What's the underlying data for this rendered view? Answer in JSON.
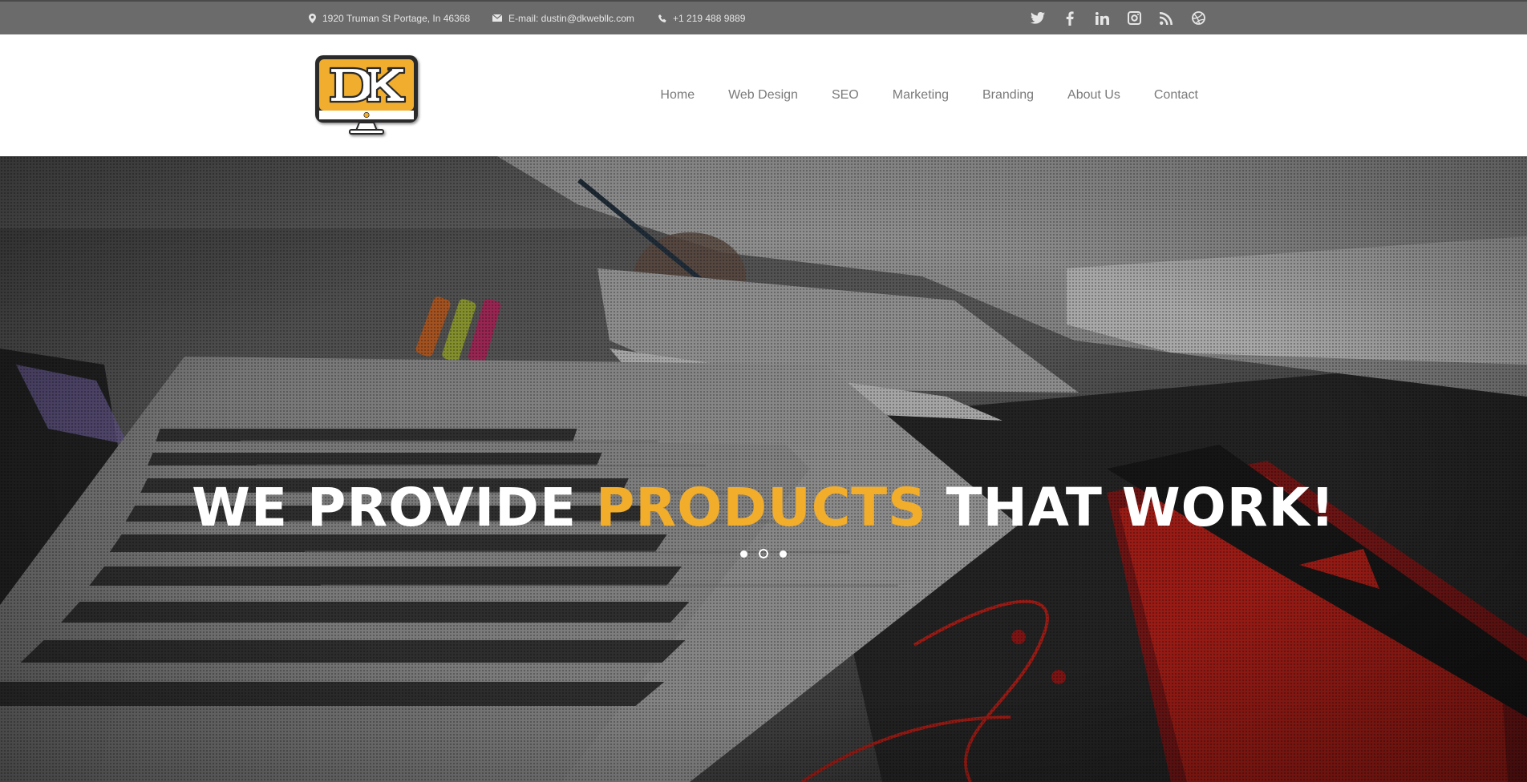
{
  "topbar": {
    "address": "1920 Truman St Portage, In 46368",
    "email": "E-mail: dustin@dkwebllc.com",
    "phone": "+1 219 488 9889",
    "social": [
      "twitter-icon",
      "facebook-icon",
      "linkedin-icon",
      "instagram-icon",
      "rss-icon",
      "dribbble-icon"
    ]
  },
  "logo": {
    "text": "DK"
  },
  "nav": {
    "items": [
      {
        "label": "Home"
      },
      {
        "label": "Web Design"
      },
      {
        "label": "SEO"
      },
      {
        "label": "Marketing"
      },
      {
        "label": "Branding"
      },
      {
        "label": "About Us"
      },
      {
        "label": "Contact"
      }
    ]
  },
  "hero": {
    "headline_pre": "WE PROVIDE ",
    "headline_highlight": "PRODUCTS",
    "headline_post": " THAT WORK!",
    "slides": 3,
    "active_slide": 2
  },
  "colors": {
    "accent": "#f2ad2b",
    "topbar": "#6b6b6b",
    "nav_text": "#7a7a7a"
  }
}
